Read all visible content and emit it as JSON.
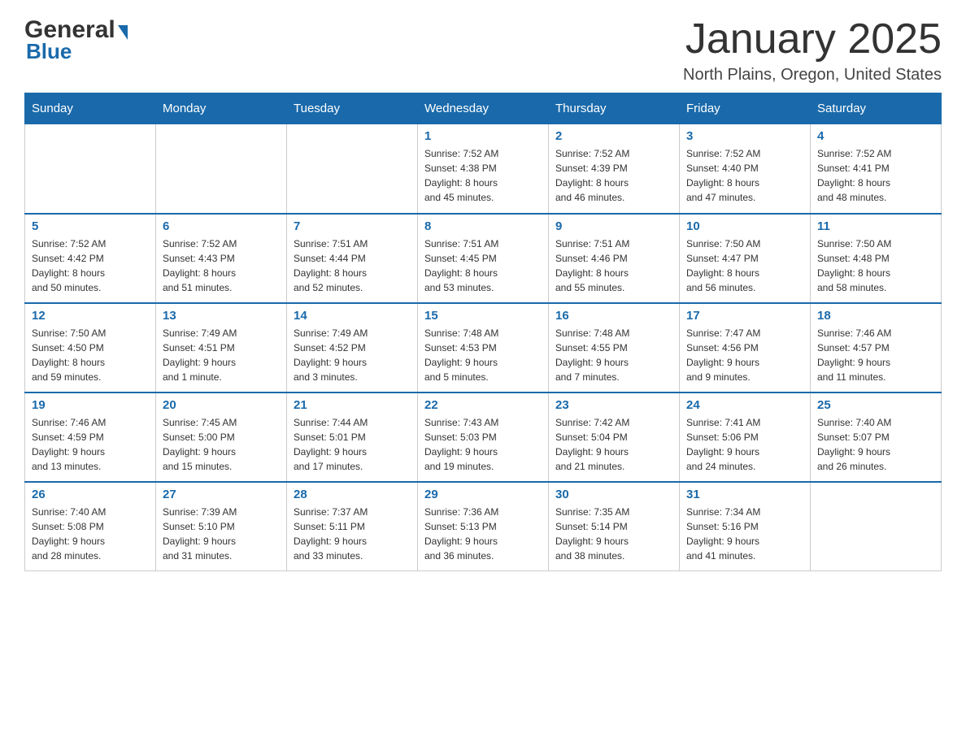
{
  "header": {
    "logo_general": "General",
    "logo_blue": "Blue",
    "month_title": "January 2025",
    "location": "North Plains, Oregon, United States"
  },
  "weekdays": [
    "Sunday",
    "Monday",
    "Tuesday",
    "Wednesday",
    "Thursday",
    "Friday",
    "Saturday"
  ],
  "weeks": [
    [
      {
        "day": "",
        "info": ""
      },
      {
        "day": "",
        "info": ""
      },
      {
        "day": "",
        "info": ""
      },
      {
        "day": "1",
        "info": "Sunrise: 7:52 AM\nSunset: 4:38 PM\nDaylight: 8 hours\nand 45 minutes."
      },
      {
        "day": "2",
        "info": "Sunrise: 7:52 AM\nSunset: 4:39 PM\nDaylight: 8 hours\nand 46 minutes."
      },
      {
        "day": "3",
        "info": "Sunrise: 7:52 AM\nSunset: 4:40 PM\nDaylight: 8 hours\nand 47 minutes."
      },
      {
        "day": "4",
        "info": "Sunrise: 7:52 AM\nSunset: 4:41 PM\nDaylight: 8 hours\nand 48 minutes."
      }
    ],
    [
      {
        "day": "5",
        "info": "Sunrise: 7:52 AM\nSunset: 4:42 PM\nDaylight: 8 hours\nand 50 minutes."
      },
      {
        "day": "6",
        "info": "Sunrise: 7:52 AM\nSunset: 4:43 PM\nDaylight: 8 hours\nand 51 minutes."
      },
      {
        "day": "7",
        "info": "Sunrise: 7:51 AM\nSunset: 4:44 PM\nDaylight: 8 hours\nand 52 minutes."
      },
      {
        "day": "8",
        "info": "Sunrise: 7:51 AM\nSunset: 4:45 PM\nDaylight: 8 hours\nand 53 minutes."
      },
      {
        "day": "9",
        "info": "Sunrise: 7:51 AM\nSunset: 4:46 PM\nDaylight: 8 hours\nand 55 minutes."
      },
      {
        "day": "10",
        "info": "Sunrise: 7:50 AM\nSunset: 4:47 PM\nDaylight: 8 hours\nand 56 minutes."
      },
      {
        "day": "11",
        "info": "Sunrise: 7:50 AM\nSunset: 4:48 PM\nDaylight: 8 hours\nand 58 minutes."
      }
    ],
    [
      {
        "day": "12",
        "info": "Sunrise: 7:50 AM\nSunset: 4:50 PM\nDaylight: 8 hours\nand 59 minutes."
      },
      {
        "day": "13",
        "info": "Sunrise: 7:49 AM\nSunset: 4:51 PM\nDaylight: 9 hours\nand 1 minute."
      },
      {
        "day": "14",
        "info": "Sunrise: 7:49 AM\nSunset: 4:52 PM\nDaylight: 9 hours\nand 3 minutes."
      },
      {
        "day": "15",
        "info": "Sunrise: 7:48 AM\nSunset: 4:53 PM\nDaylight: 9 hours\nand 5 minutes."
      },
      {
        "day": "16",
        "info": "Sunrise: 7:48 AM\nSunset: 4:55 PM\nDaylight: 9 hours\nand 7 minutes."
      },
      {
        "day": "17",
        "info": "Sunrise: 7:47 AM\nSunset: 4:56 PM\nDaylight: 9 hours\nand 9 minutes."
      },
      {
        "day": "18",
        "info": "Sunrise: 7:46 AM\nSunset: 4:57 PM\nDaylight: 9 hours\nand 11 minutes."
      }
    ],
    [
      {
        "day": "19",
        "info": "Sunrise: 7:46 AM\nSunset: 4:59 PM\nDaylight: 9 hours\nand 13 minutes."
      },
      {
        "day": "20",
        "info": "Sunrise: 7:45 AM\nSunset: 5:00 PM\nDaylight: 9 hours\nand 15 minutes."
      },
      {
        "day": "21",
        "info": "Sunrise: 7:44 AM\nSunset: 5:01 PM\nDaylight: 9 hours\nand 17 minutes."
      },
      {
        "day": "22",
        "info": "Sunrise: 7:43 AM\nSunset: 5:03 PM\nDaylight: 9 hours\nand 19 minutes."
      },
      {
        "day": "23",
        "info": "Sunrise: 7:42 AM\nSunset: 5:04 PM\nDaylight: 9 hours\nand 21 minutes."
      },
      {
        "day": "24",
        "info": "Sunrise: 7:41 AM\nSunset: 5:06 PM\nDaylight: 9 hours\nand 24 minutes."
      },
      {
        "day": "25",
        "info": "Sunrise: 7:40 AM\nSunset: 5:07 PM\nDaylight: 9 hours\nand 26 minutes."
      }
    ],
    [
      {
        "day": "26",
        "info": "Sunrise: 7:40 AM\nSunset: 5:08 PM\nDaylight: 9 hours\nand 28 minutes."
      },
      {
        "day": "27",
        "info": "Sunrise: 7:39 AM\nSunset: 5:10 PM\nDaylight: 9 hours\nand 31 minutes."
      },
      {
        "day": "28",
        "info": "Sunrise: 7:37 AM\nSunset: 5:11 PM\nDaylight: 9 hours\nand 33 minutes."
      },
      {
        "day": "29",
        "info": "Sunrise: 7:36 AM\nSunset: 5:13 PM\nDaylight: 9 hours\nand 36 minutes."
      },
      {
        "day": "30",
        "info": "Sunrise: 7:35 AM\nSunset: 5:14 PM\nDaylight: 9 hours\nand 38 minutes."
      },
      {
        "day": "31",
        "info": "Sunrise: 7:34 AM\nSunset: 5:16 PM\nDaylight: 9 hours\nand 41 minutes."
      },
      {
        "day": "",
        "info": ""
      }
    ]
  ],
  "colors": {
    "header_bg": "#1a6aab",
    "header_text": "#ffffff",
    "day_number": "#1a6aab",
    "border": "#cccccc",
    "row_border_bottom": "#1a6aab"
  }
}
